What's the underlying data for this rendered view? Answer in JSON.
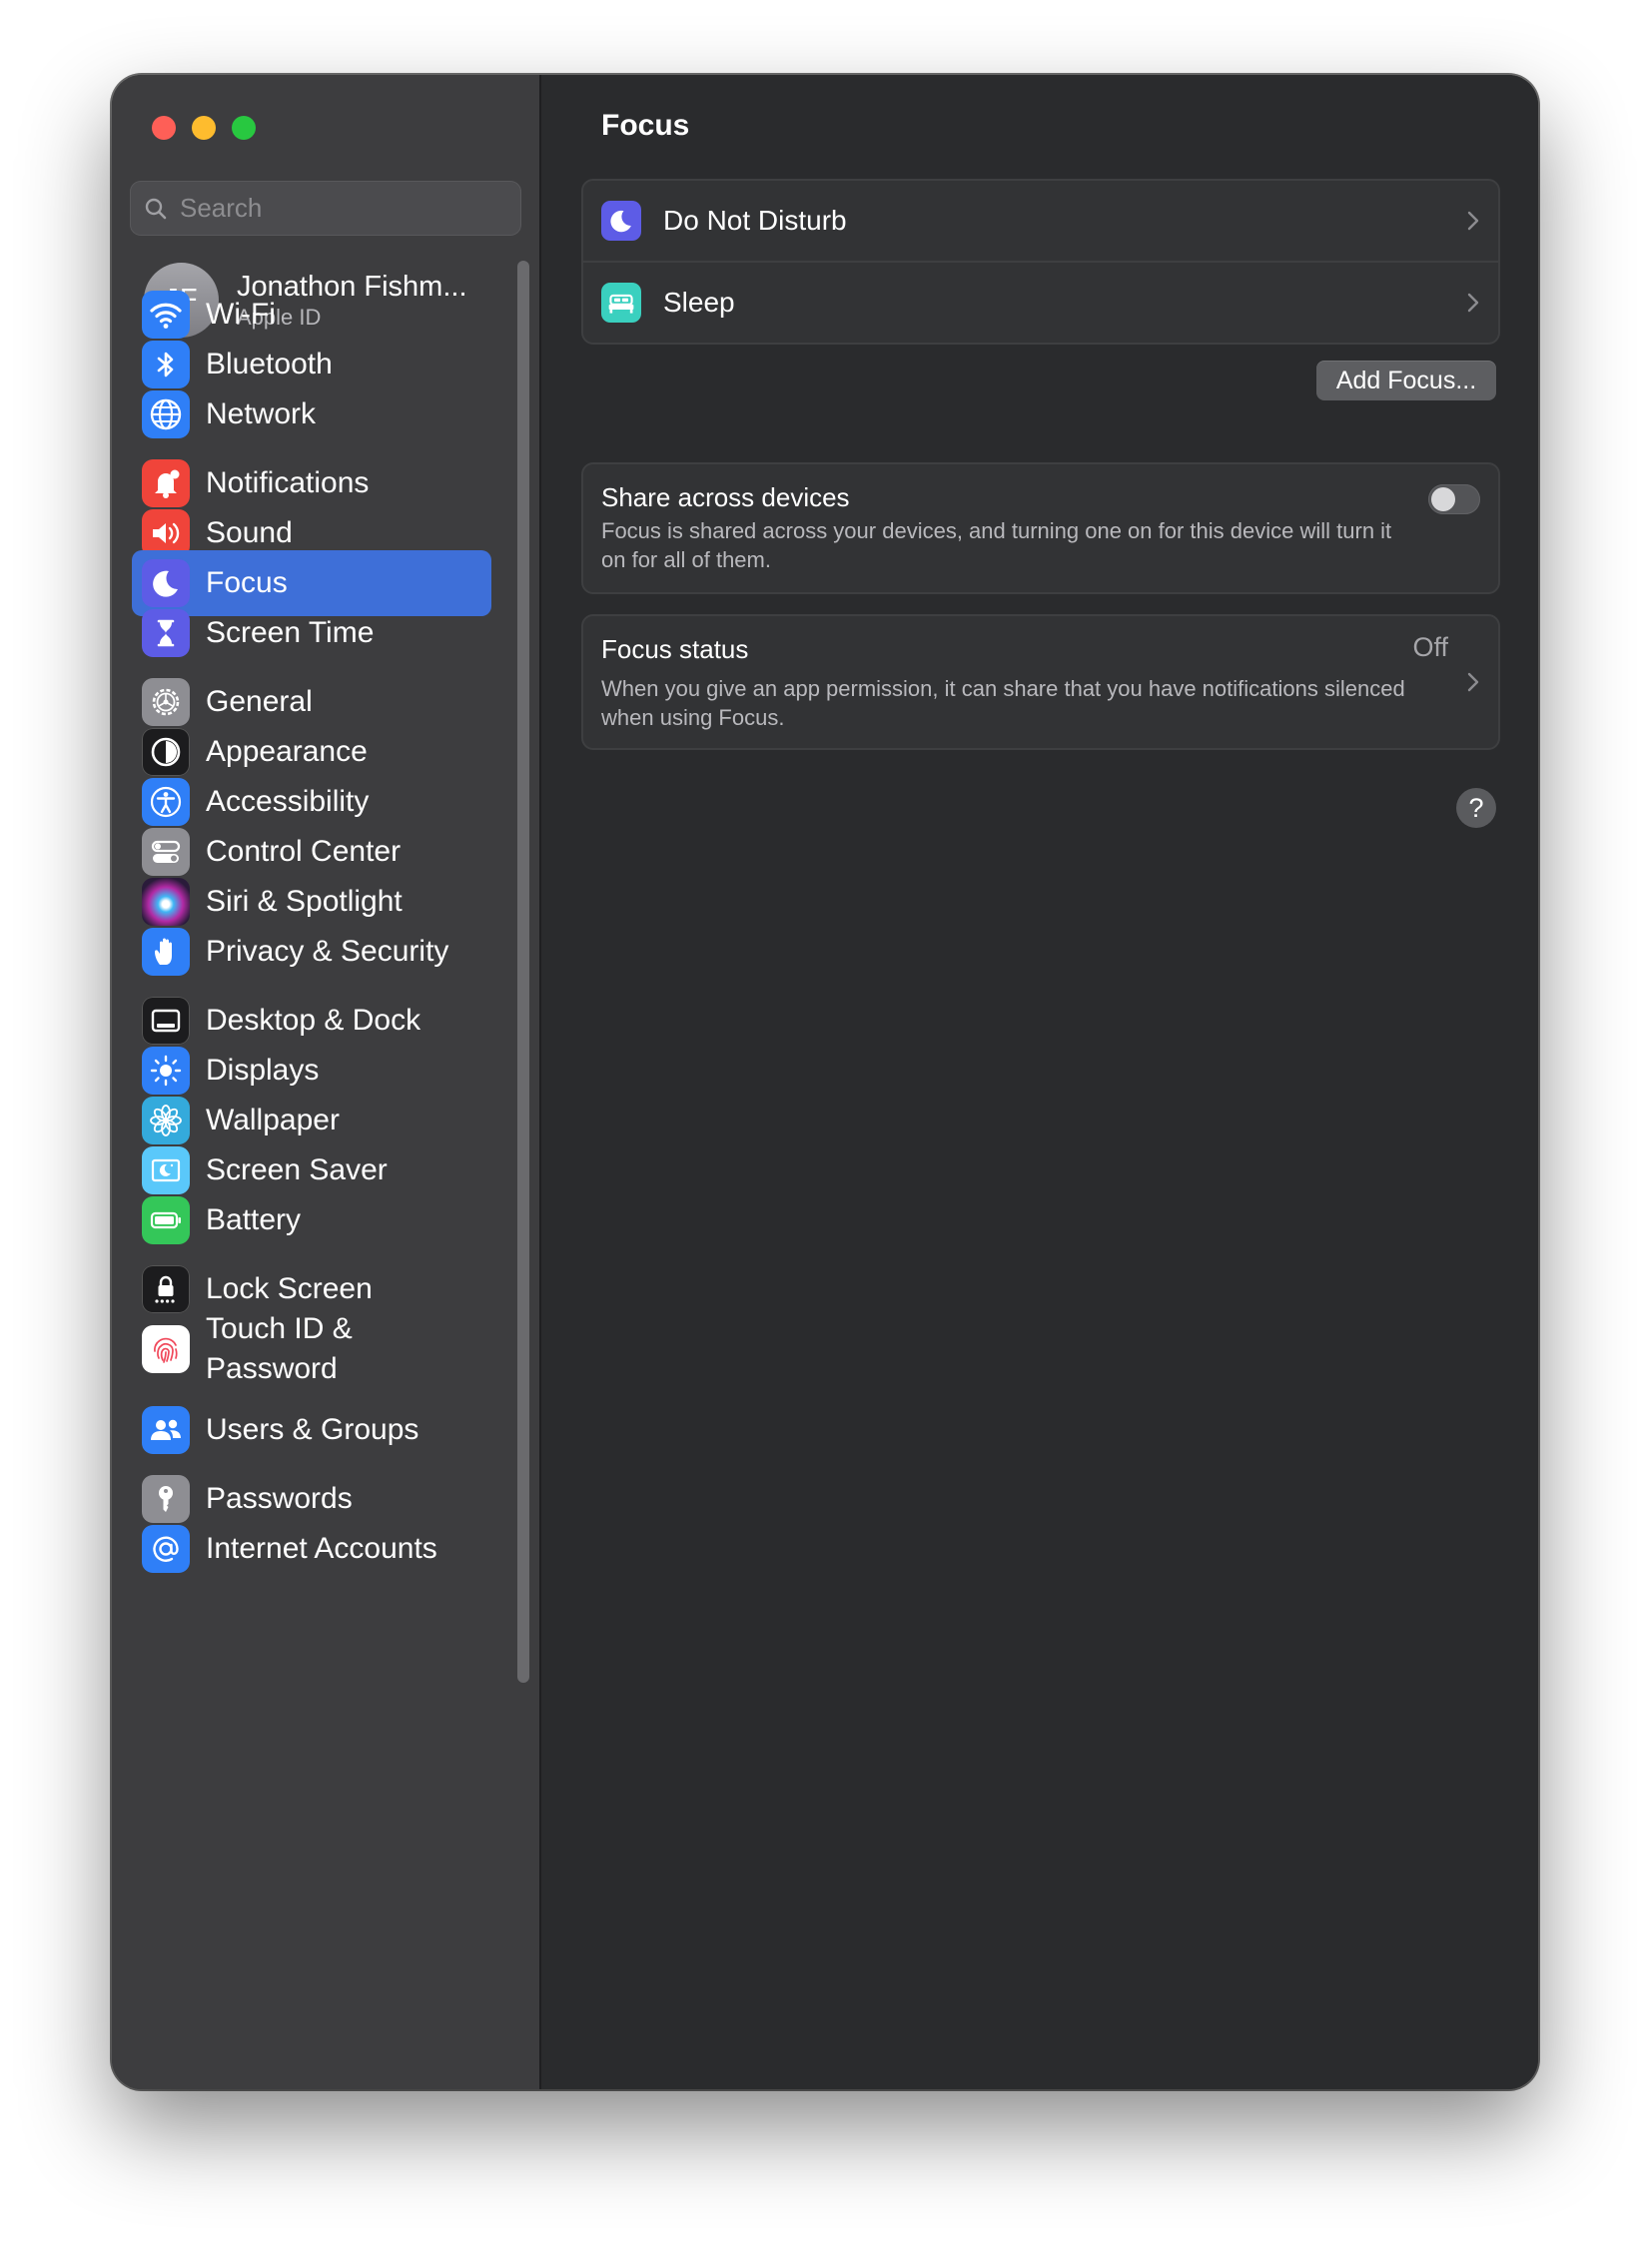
{
  "sidebar": {
    "search_placeholder": "Search",
    "account": {
      "initials": "JF",
      "name": "Jonathon Fishm...",
      "subtitle": "Apple ID"
    },
    "items": [
      {
        "label": "Wi-Fi",
        "icon": "wifi-icon",
        "color": "#2f7ff7"
      },
      {
        "label": "Bluetooth",
        "icon": "bluetooth-icon",
        "color": "#2f7ff7"
      },
      {
        "label": "Network",
        "icon": "globe-icon",
        "color": "#2f7ff7"
      },
      {
        "label": "Notifications",
        "icon": "bell-icon",
        "color": "#f0443a"
      },
      {
        "label": "Sound",
        "icon": "speaker-icon",
        "color": "#f0443a"
      },
      {
        "label": "Focus",
        "icon": "moon-icon",
        "color": "#5d5ce6",
        "active": true
      },
      {
        "label": "Screen Time",
        "icon": "hourglass-icon",
        "color": "#5d5ce6"
      },
      {
        "label": "General",
        "icon": "gear-icon",
        "color": "#8e8e93"
      },
      {
        "label": "Appearance",
        "icon": "appearance-icon",
        "color": "#1c1c1e"
      },
      {
        "label": "Accessibility",
        "icon": "accessibility-icon",
        "color": "#2f7ff7"
      },
      {
        "label": "Control Center",
        "icon": "control-center-icon",
        "color": "#8e8e93"
      },
      {
        "label": "Siri & Spotlight",
        "icon": "siri-icon",
        "color": "#b0306b"
      },
      {
        "label": "Privacy & Security",
        "icon": "hand-icon",
        "color": "#2f7ff7"
      },
      {
        "label": "Desktop & Dock",
        "icon": "dock-icon",
        "color": "#1c1c1e"
      },
      {
        "label": "Displays",
        "icon": "sun-icon",
        "color": "#2f7ff7"
      },
      {
        "label": "Wallpaper",
        "icon": "flower-icon",
        "color": "#34aadc"
      },
      {
        "label": "Screen Saver",
        "icon": "screen-saver-icon",
        "color": "#5ac8fa"
      },
      {
        "label": "Battery",
        "icon": "battery-icon",
        "color": "#34c759"
      },
      {
        "label": "Lock Screen",
        "icon": "lock-icon",
        "color": "#1c1c1e"
      },
      {
        "label": "Touch ID &\nPassword",
        "icon": "fingerprint-icon",
        "color": "#ffffff"
      },
      {
        "label": "Users & Groups",
        "icon": "users-icon",
        "color": "#2f7ff7"
      },
      {
        "label": "Passwords",
        "icon": "key-icon",
        "color": "#8e8e93"
      },
      {
        "label": "Internet Accounts",
        "icon": "at-icon",
        "color": "#2f7ff7"
      }
    ]
  },
  "main": {
    "title": "Focus",
    "focus_modes": [
      {
        "label": "Do Not Disturb",
        "icon": "moon-icon",
        "color": "#5d5ce6"
      },
      {
        "label": "Sleep",
        "icon": "bed-icon",
        "color": "#3ad0bf"
      }
    ],
    "add_focus_label": "Add Focus...",
    "share": {
      "title": "Share across devices",
      "description": "Focus is shared across your devices, and turning one on for this device will turn it on for all of them.",
      "enabled": false
    },
    "status": {
      "title": "Focus status",
      "value": "Off",
      "description": "When you give an app permission, it can share that you have notifications silenced when using Focus."
    },
    "help_label": "?"
  }
}
